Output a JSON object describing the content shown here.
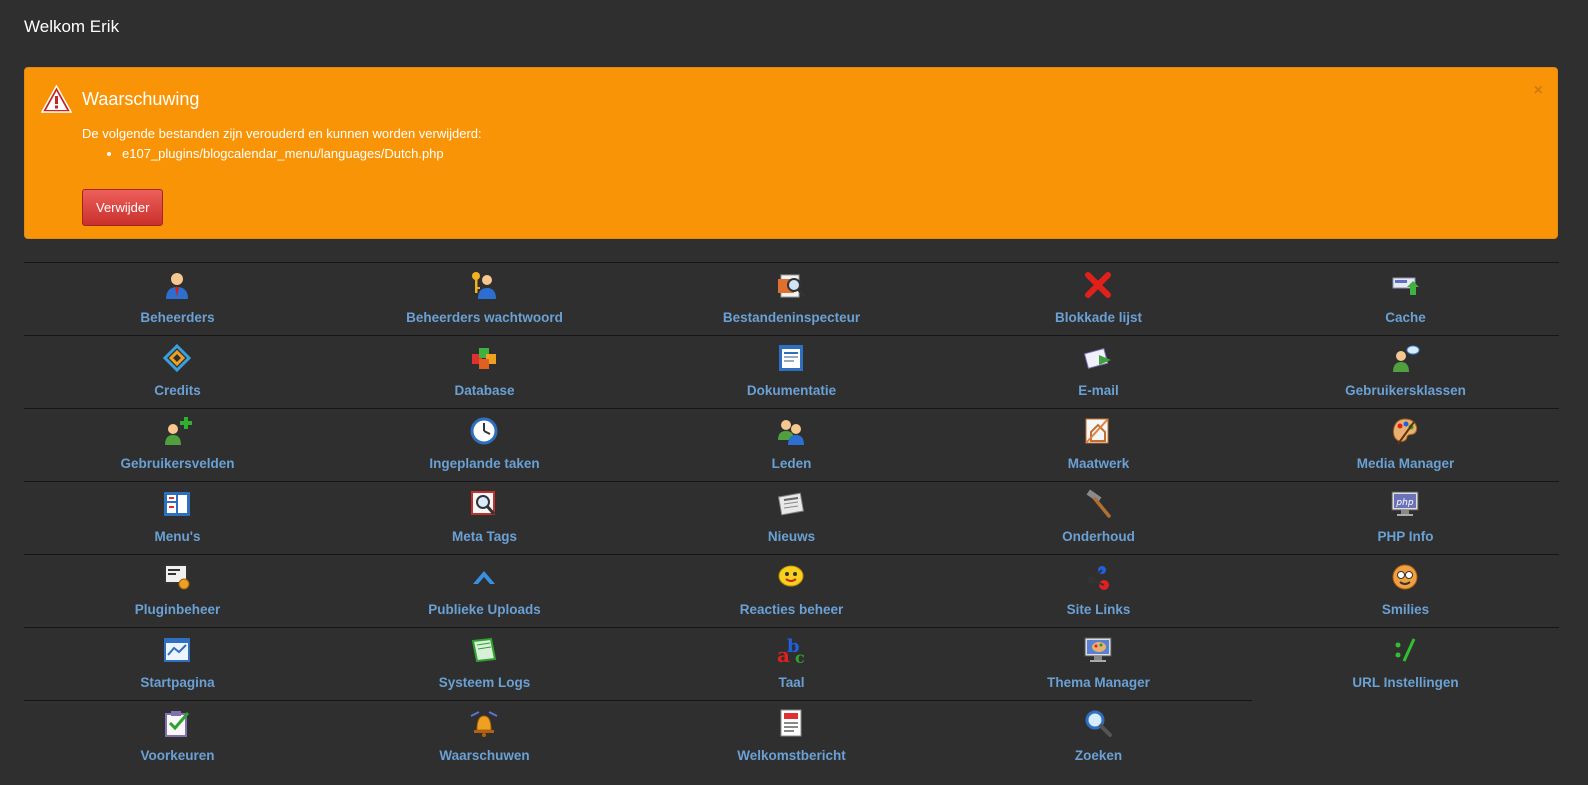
{
  "welcome": "Welkom Erik",
  "alert": {
    "title": "Waarschuwing",
    "close": "×",
    "message": "De volgende bestanden zijn verouderd en kunnen worden verwijderd:",
    "files": [
      "e107_plugins/blogcalendar_menu/languages/Dutch.php"
    ],
    "button": "Verwijder"
  },
  "items": [
    {
      "label": "Beheerders",
      "icon": "admin-user-icon"
    },
    {
      "label": "Beheerders wachtwoord",
      "icon": "admin-password-icon"
    },
    {
      "label": "Bestandeninspecteur",
      "icon": "file-inspector-icon"
    },
    {
      "label": "Blokkade lijst",
      "icon": "ban-list-icon"
    },
    {
      "label": "Cache",
      "icon": "cache-icon"
    },
    {
      "label": "Credits",
      "icon": "credits-icon"
    },
    {
      "label": "Database",
      "icon": "database-icon"
    },
    {
      "label": "Dokumentatie",
      "icon": "documentation-icon"
    },
    {
      "label": "E-mail",
      "icon": "email-icon"
    },
    {
      "label": "Gebruikersklassen",
      "icon": "user-classes-icon"
    },
    {
      "label": "Gebruikersvelden",
      "icon": "user-fields-icon"
    },
    {
      "label": "Ingeplande taken",
      "icon": "clock-icon"
    },
    {
      "label": "Leden",
      "icon": "members-icon"
    },
    {
      "label": "Maatwerk",
      "icon": "custom-pages-icon"
    },
    {
      "label": "Media Manager",
      "icon": "palette-icon"
    },
    {
      "label": "Menu's",
      "icon": "menus-icon"
    },
    {
      "label": "Meta Tags",
      "icon": "meta-tags-icon"
    },
    {
      "label": "Nieuws",
      "icon": "news-icon"
    },
    {
      "label": "Onderhoud",
      "icon": "hammer-icon"
    },
    {
      "label": "PHP Info",
      "icon": "php-info-icon"
    },
    {
      "label": "Pluginbeheer",
      "icon": "plugin-manager-icon"
    },
    {
      "label": "Publieke Uploads",
      "icon": "uploads-icon"
    },
    {
      "label": "Reacties beheer",
      "icon": "comments-icon"
    },
    {
      "label": "Site Links",
      "icon": "site-links-icon"
    },
    {
      "label": "Smilies",
      "icon": "smiley-icon"
    },
    {
      "label": "Startpagina",
      "icon": "frontpage-icon"
    },
    {
      "label": "Systeem Logs",
      "icon": "system-logs-icon"
    },
    {
      "label": "Taal",
      "icon": "language-icon"
    },
    {
      "label": "Thema Manager",
      "icon": "theme-manager-icon"
    },
    {
      "label": "URL Instellingen",
      "icon": "url-settings-icon"
    },
    {
      "label": "Voorkeuren",
      "icon": "preferences-icon"
    },
    {
      "label": "Waarschuwen",
      "icon": "notify-bell-icon"
    },
    {
      "label": "Welkomstbericht",
      "icon": "welcome-message-icon"
    },
    {
      "label": "Zoeken",
      "icon": "search-icon"
    }
  ],
  "colors": {
    "background": "#2f2f2f",
    "warning": "#f89406",
    "danger_button": "#d9534f",
    "link": "#6aa0d4"
  }
}
